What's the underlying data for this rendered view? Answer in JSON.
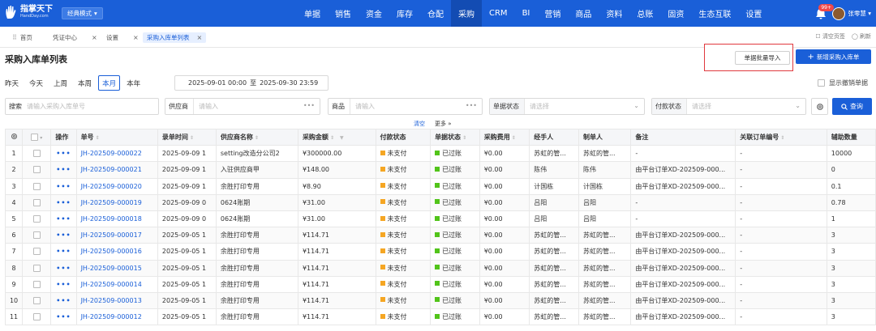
{
  "app": {
    "logo_cn": "指掌天下",
    "logo_en": "HandDay.com",
    "mode": "经典模式",
    "nav": [
      "单据",
      "销售",
      "资金",
      "库存",
      "仓配",
      "采购",
      "CRM",
      "BI",
      "营销",
      "商品",
      "资料",
      "总账",
      "固资",
      "生态互联",
      "设置"
    ],
    "active_nav": "采购",
    "notify_badge": "99+",
    "user": "张零慧"
  },
  "tabs": {
    "items": [
      {
        "label": "首页",
        "closable": false
      },
      {
        "label": "凭证中心",
        "closable": true
      },
      {
        "label": "设置",
        "closable": true
      },
      {
        "label": "采购入库单列表",
        "closable": true,
        "active": true
      }
    ],
    "right": [
      "清空页签",
      "刷新"
    ]
  },
  "page": {
    "title": "采购入库单列表",
    "import_label": "单据批量导入",
    "new_label": "新增采购入库单"
  },
  "dates": {
    "options": [
      "昨天",
      "今天",
      "上周",
      "本周",
      "本月",
      "本年"
    ],
    "active": "本月",
    "range_start": "2025-09-01 00:00",
    "range_sep": "至",
    "range_end": "2025-09-30 23:59",
    "show_revoked": "显示撤销单据"
  },
  "filters": {
    "search_label": "搜索",
    "search_placeholder": "请输入采购入库单号",
    "supplier_label": "供应商",
    "supplier_placeholder": "请输入",
    "product_label": "商品",
    "product_placeholder": "请输入",
    "doc_status_label": "单据状态",
    "doc_status_placeholder": "请选择",
    "pay_status_label": "付款状态",
    "pay_status_placeholder": "请选择",
    "query_label": "查询",
    "clear_label": "清空",
    "more_label": "更多"
  },
  "table": {
    "headers": [
      "操作",
      "单号",
      "录单时间",
      "供应商名称",
      "采购金额",
      "付款状态",
      "单据状态",
      "采购费用",
      "经手人",
      "制单人",
      "备注",
      "关联订单编号",
      "辅助数量"
    ],
    "status_colors": {
      "unpaid": "#f5a623",
      "posted": "#52c41a"
    },
    "rows": [
      {
        "no": "1",
        "ops": "•••",
        "id": "JH-202509-000022",
        "time": "2025-09-09 1",
        "supplier": "setting改造分公司2",
        "amount": "¥300000.00",
        "pay": "未支付",
        "status": "已过账",
        "fee": "¥0.00",
        "handler": "苏虹的管...",
        "maker": "苏虹的管...",
        "note": "-",
        "rel": "-",
        "qty": "10000"
      },
      {
        "no": "2",
        "ops": "•••",
        "id": "JH-202509-000021",
        "time": "2025-09-09 1",
        "supplier": "入驻供应商甲",
        "amount": "¥148.00",
        "pay": "未支付",
        "status": "已过账",
        "fee": "¥0.00",
        "handler": "陈伟",
        "maker": "陈伟",
        "note": "由平台订单XD-202509-000...",
        "rel": "-",
        "qty": "0"
      },
      {
        "no": "3",
        "ops": "•••",
        "id": "JH-202509-000020",
        "time": "2025-09-09 1",
        "supplier": "余胜打印专用",
        "amount": "¥8.90",
        "pay": "未支付",
        "status": "已过账",
        "fee": "¥0.00",
        "handler": "计国栋",
        "maker": "计国栋",
        "note": "由平台订单XD-202509-000...",
        "rel": "-",
        "qty": "0.1"
      },
      {
        "no": "4",
        "ops": "•••",
        "id": "JH-202509-000019",
        "time": "2025-09-09 0",
        "supplier": "0624账期",
        "amount": "¥31.00",
        "pay": "未支付",
        "status": "已过账",
        "fee": "¥0.00",
        "handler": "吕阳",
        "maker": "吕阳",
        "note": "-",
        "rel": "-",
        "qty": "0.78"
      },
      {
        "no": "5",
        "ops": "•••",
        "id": "JH-202509-000018",
        "time": "2025-09-09 0",
        "supplier": "0624账期",
        "amount": "¥31.00",
        "pay": "未支付",
        "status": "已过账",
        "fee": "¥0.00",
        "handler": "吕阳",
        "maker": "吕阳",
        "note": "-",
        "rel": "-",
        "qty": "1"
      },
      {
        "no": "6",
        "ops": "•••",
        "id": "JH-202509-000017",
        "time": "2025-09-05 1",
        "supplier": "余胜打印专用",
        "amount": "¥114.71",
        "pay": "未支付",
        "status": "已过账",
        "fee": "¥0.00",
        "handler": "苏虹的管...",
        "maker": "苏虹的管...",
        "note": "由平台订单XD-202509-000...",
        "rel": "-",
        "qty": "3"
      },
      {
        "no": "7",
        "ops": "•••",
        "id": "JH-202509-000016",
        "time": "2025-09-05 1",
        "supplier": "余胜打印专用",
        "amount": "¥114.71",
        "pay": "未支付",
        "status": "已过账",
        "fee": "¥0.00",
        "handler": "苏虹的管...",
        "maker": "苏虹的管...",
        "note": "由平台订单XD-202509-000...",
        "rel": "-",
        "qty": "3"
      },
      {
        "no": "8",
        "ops": "•••",
        "id": "JH-202509-000015",
        "time": "2025-09-05 1",
        "supplier": "余胜打印专用",
        "amount": "¥114.71",
        "pay": "未支付",
        "status": "已过账",
        "fee": "¥0.00",
        "handler": "苏虹的管...",
        "maker": "苏虹的管...",
        "note": "由平台订单XD-202509-000...",
        "rel": "-",
        "qty": "3"
      },
      {
        "no": "9",
        "ops": "•••",
        "id": "JH-202509-000014",
        "time": "2025-09-05 1",
        "supplier": "余胜打印专用",
        "amount": "¥114.71",
        "pay": "未支付",
        "status": "已过账",
        "fee": "¥0.00",
        "handler": "苏虹的管...",
        "maker": "苏虹的管...",
        "note": "由平台订单XD-202509-000...",
        "rel": "-",
        "qty": "3"
      },
      {
        "no": "10",
        "ops": "•••",
        "id": "JH-202509-000013",
        "time": "2025-09-05 1",
        "supplier": "余胜打印专用",
        "amount": "¥114.71",
        "pay": "未支付",
        "status": "已过账",
        "fee": "¥0.00",
        "handler": "苏虹的管...",
        "maker": "苏虹的管...",
        "note": "由平台订单XD-202509-000...",
        "rel": "-",
        "qty": "3"
      },
      {
        "no": "11",
        "ops": "•••",
        "id": "JH-202509-000012",
        "time": "2025-09-05 1",
        "supplier": "余胜打印专用",
        "amount": "¥114.71",
        "pay": "未支付",
        "status": "已过账",
        "fee": "¥0.00",
        "handler": "苏虹的管...",
        "maker": "苏虹的管...",
        "note": "由平台订单XD-202509-000...",
        "rel": "-",
        "qty": "3"
      }
    ]
  }
}
